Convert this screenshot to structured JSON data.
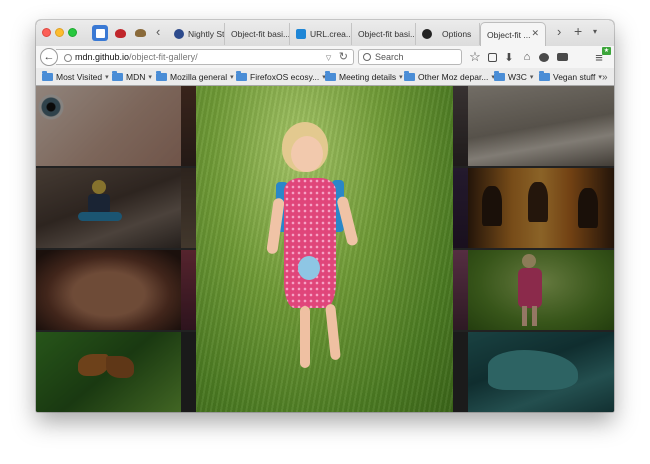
{
  "browser": {
    "tabs": [
      {
        "label": "Nightly St..."
      },
      {
        "label": "Object-fit basi..."
      },
      {
        "label": "URL.crea..."
      },
      {
        "label": "Object-fit basi..."
      },
      {
        "label": "Options"
      },
      {
        "label": "Object-fit ..."
      }
    ],
    "url_host": "mdn.github.io",
    "url_path": "/object-fit-gallery/",
    "search_placeholder": "Search"
  },
  "bookmarks": [
    {
      "label": "Most Visited"
    },
    {
      "label": "MDN"
    },
    {
      "label": "Mozilla general"
    },
    {
      "label": "FirefoxOS ecosy..."
    },
    {
      "label": "Meeting details"
    },
    {
      "label": "Other Moz depar..."
    },
    {
      "label": "W3C"
    },
    {
      "label": "Vegan stuff"
    }
  ],
  "colors": {
    "toolbar": "#f5f5f5",
    "tabstrip": "#e2e2e2",
    "folder_icon": "#4a8dd6",
    "gallery_bg": "#222222",
    "grass": "#5a8a2a",
    "dress": "#e0457a"
  },
  "icons": [
    "close-window-icon",
    "minimize-icon",
    "maximize-icon",
    "pocket-icon",
    "ladybug-icon",
    "hedgehog-icon",
    "globe-icon",
    "github-icon",
    "back-arrow-icon",
    "reload-icon",
    "search-icon",
    "bookmark-star-icon",
    "reading-list-icon",
    "download-icon",
    "home-icon",
    "chat-icon",
    "youtube-icon",
    "menu-icon",
    "folder-icon"
  ],
  "gallery": {
    "photos": [
      {
        "subject": "eye-closeup"
      },
      {
        "subject": "rock-pool"
      },
      {
        "subject": "woman-sitting-on-rock"
      },
      {
        "subject": "firelight-figures"
      },
      {
        "subject": "bronze-artifact"
      },
      {
        "subject": "girl-in-pink-dress"
      },
      {
        "subject": "butterfly-on-leaf"
      },
      {
        "subject": "teal-vehicle"
      }
    ]
  }
}
